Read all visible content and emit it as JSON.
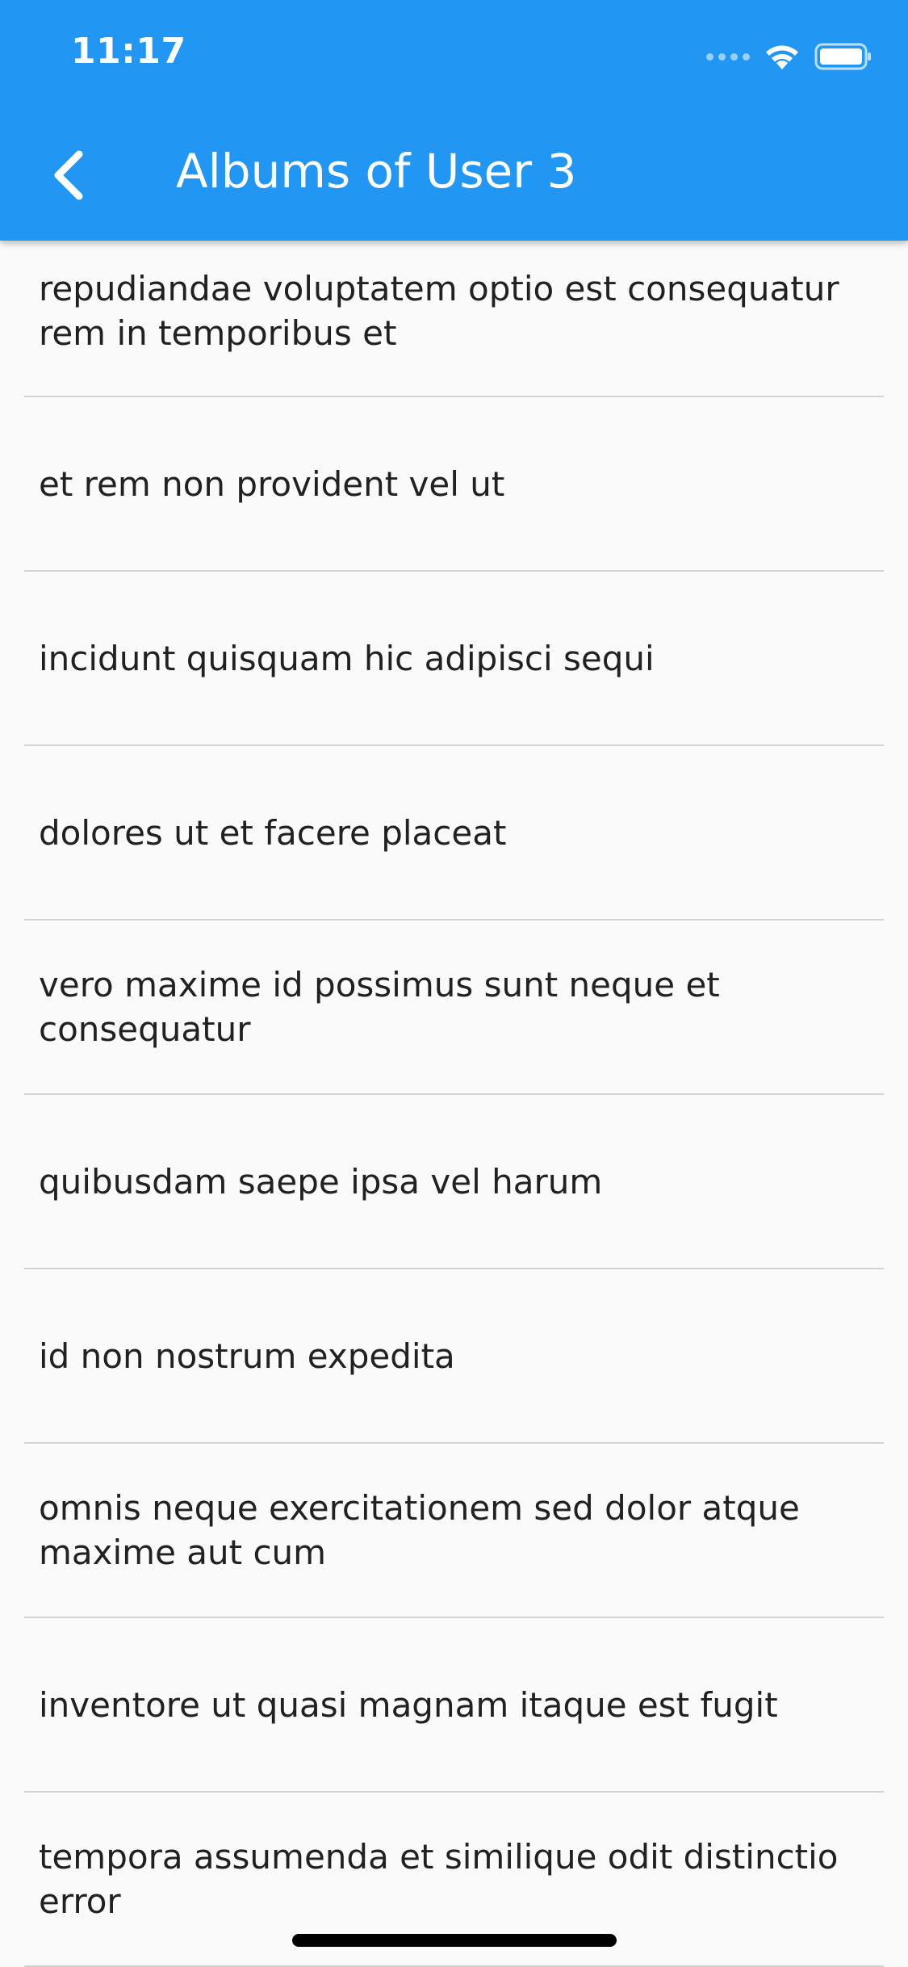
{
  "status_bar": {
    "time": "11:17"
  },
  "appbar": {
    "title": "Albums of User 3",
    "color": "#2196f3"
  },
  "albums": [
    {
      "title": "repudiandae voluptatem optio est consequatur rem in temporibus et"
    },
    {
      "title": "et rem non provident vel ut"
    },
    {
      "title": "incidunt quisquam hic adipisci sequi"
    },
    {
      "title": "dolores ut et facere placeat"
    },
    {
      "title": "vero maxime id possimus sunt neque et consequatur"
    },
    {
      "title": "quibusdam saepe ipsa vel harum"
    },
    {
      "title": "id non nostrum expedita"
    },
    {
      "title": "omnis neque exercitationem sed dolor atque maxime aut cum"
    },
    {
      "title": "inventore ut quasi magnam itaque est fugit"
    },
    {
      "title": "tempora assumenda et similique odit distinctio error"
    }
  ],
  "icons": {
    "back": "chevron-left-icon",
    "wifi": "wifi-icon",
    "battery": "battery-icon",
    "signal": "cellular-signal-icon"
  }
}
